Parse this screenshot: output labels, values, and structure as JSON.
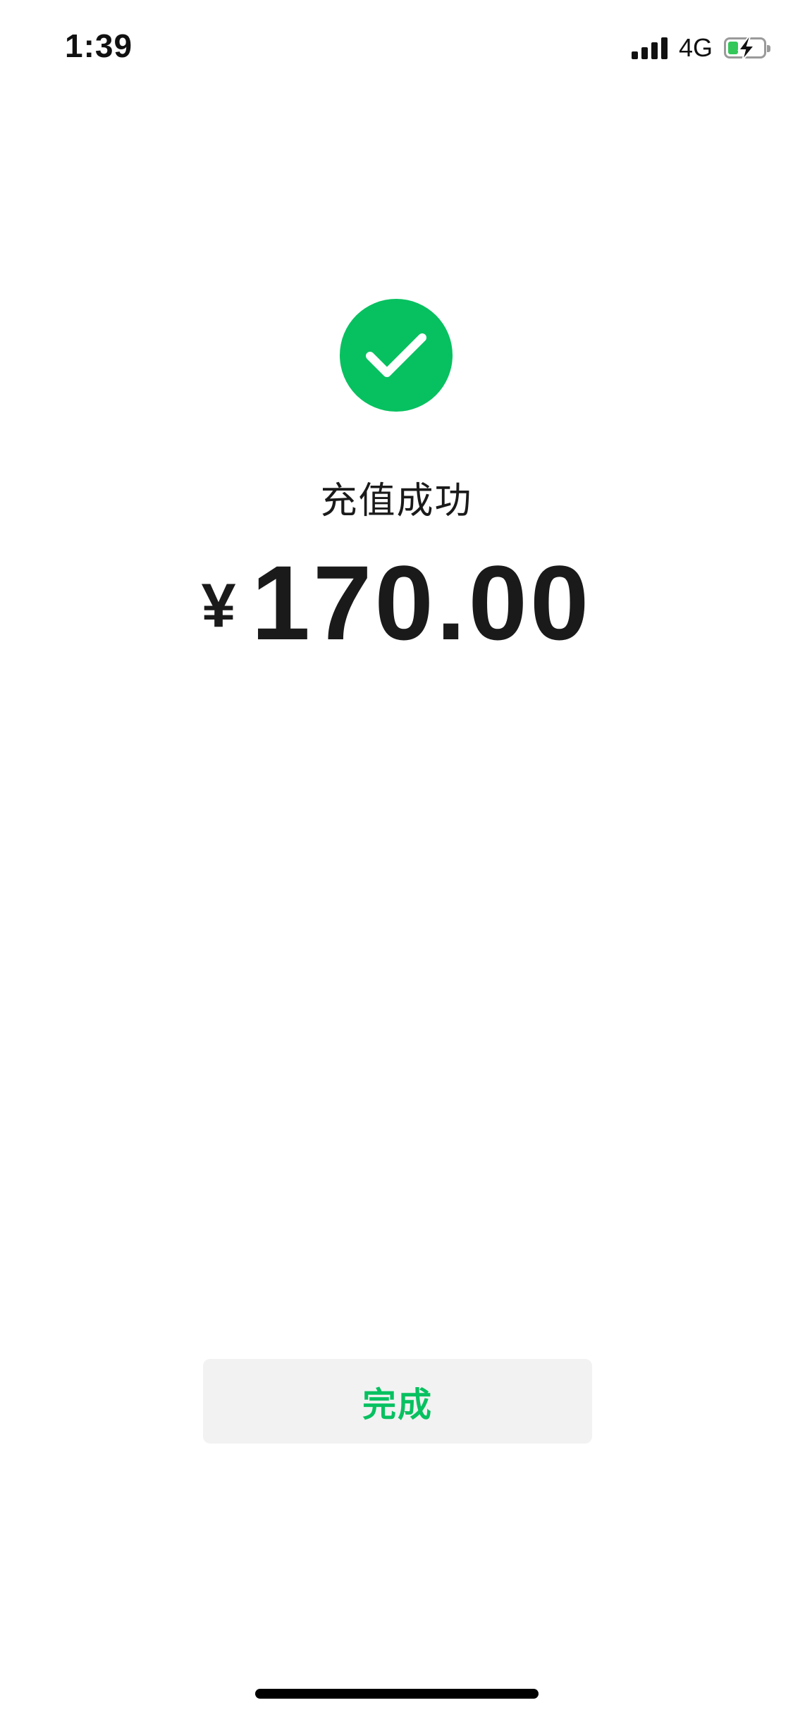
{
  "status_bar": {
    "time": "1:39",
    "network": "4G",
    "signal_icon": "cellular-signal-icon",
    "battery_icon": "battery-charging-icon",
    "battery_level": 0.3
  },
  "result": {
    "icon": "checkmark-circle-icon",
    "title": "充值成功",
    "currency_symbol": "¥",
    "amount": "170.00"
  },
  "actions": {
    "done_label": "完成"
  },
  "colors": {
    "accent_green": "#07c160",
    "button_bg": "#f2f2f2",
    "text_primary": "#1a1a1a",
    "battery_green": "#34c759"
  }
}
